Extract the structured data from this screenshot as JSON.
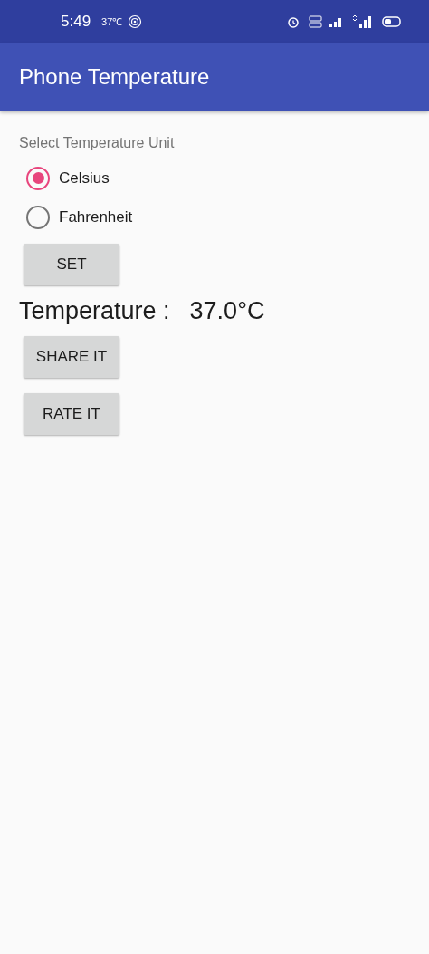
{
  "status_bar": {
    "time": "5:49",
    "temperature": "37℃"
  },
  "app_bar": {
    "title": "Phone Temperature"
  },
  "unit_label": "Select Temperature Unit",
  "units": [
    {
      "label": "Celsius",
      "selected": true
    },
    {
      "label": "Fahrenheit",
      "selected": false
    }
  ],
  "set_button": "SET",
  "temperature": {
    "label": "Temperature :",
    "value": "37.0°C"
  },
  "buttons": [
    "SHARE IT",
    "RATE IT"
  ]
}
